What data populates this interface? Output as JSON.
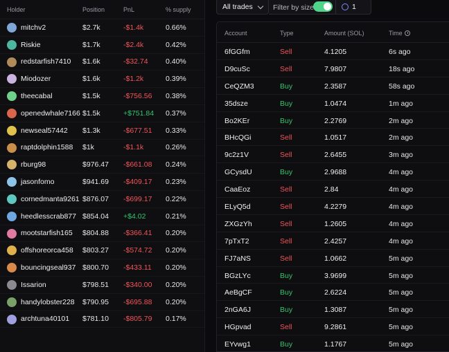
{
  "holders": {
    "headers": {
      "holder": "Holder",
      "position": "Position",
      "pnl": "PnL",
      "supply": "% supply"
    },
    "rows": [
      {
        "name": "mitchv2",
        "position": "$2.7k",
        "pnl": "-$1.4k",
        "supply": "0.66%",
        "pnl_sign": "neg",
        "avatar_color": "#7fa6d6"
      },
      {
        "name": "Riskie",
        "position": "$1.7k",
        "pnl": "-$2.4k",
        "supply": "0.42%",
        "pnl_sign": "neg",
        "avatar_color": "#4db5a0"
      },
      {
        "name": "redstarfish7410",
        "position": "$1.6k",
        "pnl": "-$32.74",
        "supply": "0.40%",
        "pnl_sign": "neg",
        "avatar_color": "#b08a5a"
      },
      {
        "name": "Miodozer",
        "position": "$1.6k",
        "pnl": "-$1.2k",
        "supply": "0.39%",
        "pnl_sign": "neg",
        "avatar_color": "#c9b3e0"
      },
      {
        "name": "theecabal",
        "position": "$1.5k",
        "pnl": "-$756.56",
        "supply": "0.38%",
        "pnl_sign": "neg",
        "avatar_color": "#6fd08a"
      },
      {
        "name": "openedwhale7166",
        "position": "$1.5k",
        "pnl": "+$751.84",
        "supply": "0.37%",
        "pnl_sign": "pos",
        "avatar_color": "#d9664a"
      },
      {
        "name": "newseal57442",
        "position": "$1.3k",
        "pnl": "-$677.51",
        "supply": "0.33%",
        "pnl_sign": "neg",
        "avatar_color": "#e0c24a"
      },
      {
        "name": "raptdolphin1588",
        "position": "$1k",
        "pnl": "-$1.1k",
        "supply": "0.26%",
        "pnl_sign": "neg",
        "avatar_color": "#c98f4a"
      },
      {
        "name": "rburg98",
        "position": "$976.47",
        "pnl": "-$661.08",
        "supply": "0.24%",
        "pnl_sign": "neg",
        "avatar_color": "#d6b36a"
      },
      {
        "name": "jasonfomo",
        "position": "$941.69",
        "pnl": "-$409.17",
        "supply": "0.23%",
        "pnl_sign": "neg",
        "avatar_color": "#8ec3e8"
      },
      {
        "name": "cornedmanta9261",
        "position": "$876.07",
        "pnl": "-$699.17",
        "supply": "0.22%",
        "pnl_sign": "neg",
        "avatar_color": "#5ec8c0"
      },
      {
        "name": "heedlesscrab877",
        "position": "$854.04",
        "pnl": "+$4.02",
        "supply": "0.21%",
        "pnl_sign": "pos",
        "avatar_color": "#6fa8e0"
      },
      {
        "name": "mootstarfish165",
        "position": "$804.88",
        "pnl": "-$366.41",
        "supply": "0.20%",
        "pnl_sign": "neg",
        "avatar_color": "#e07aa0"
      },
      {
        "name": "offshoreorca458",
        "position": "$803.27",
        "pnl": "-$574.72",
        "supply": "0.20%",
        "pnl_sign": "neg",
        "avatar_color": "#e0b04a"
      },
      {
        "name": "bouncingseal937",
        "position": "$800.70",
        "pnl": "-$433.11",
        "supply": "0.20%",
        "pnl_sign": "neg",
        "avatar_color": "#d98a4a"
      },
      {
        "name": "Issarion",
        "position": "$798.51",
        "pnl": "-$340.00",
        "supply": "0.20%",
        "pnl_sign": "neg",
        "avatar_color": "#8a8a90"
      },
      {
        "name": "handylobster228",
        "position": "$790.95",
        "pnl": "-$695.88",
        "supply": "0.20%",
        "pnl_sign": "neg",
        "avatar_color": "#7aa06a"
      },
      {
        "name": "archtuna40101",
        "position": "$781.10",
        "pnl": "-$805.79",
        "supply": "0.17%",
        "pnl_sign": "neg",
        "avatar_color": "#a0a0e0"
      }
    ]
  },
  "controls": {
    "trades_filter": "All trades",
    "filter_by_size_label": "Filter by size",
    "size_value": "1"
  },
  "trades": {
    "headers": {
      "account": "Account",
      "type": "Type",
      "amount": "Amount (SOL)",
      "time": "Time"
    },
    "rows": [
      {
        "account": "6fGGfm",
        "type": "Sell",
        "amount": "4.1205",
        "time": "6s ago"
      },
      {
        "account": "D9cuSc",
        "type": "Sell",
        "amount": "7.9807",
        "time": "18s ago"
      },
      {
        "account": "CeQZM3",
        "type": "Buy",
        "amount": "2.3587",
        "time": "58s ago"
      },
      {
        "account": "35dsze",
        "type": "Buy",
        "amount": "1.0474",
        "time": "1m ago"
      },
      {
        "account": "Bo2KEr",
        "type": "Buy",
        "amount": "2.2769",
        "time": "2m ago"
      },
      {
        "account": "BHcQGi",
        "type": "Sell",
        "amount": "1.0517",
        "time": "2m ago"
      },
      {
        "account": "9c2z1V",
        "type": "Sell",
        "amount": "2.6455",
        "time": "3m ago"
      },
      {
        "account": "GCysdU",
        "type": "Buy",
        "amount": "2.9688",
        "time": "4m ago"
      },
      {
        "account": "CaaEoz",
        "type": "Sell",
        "amount": "2.84",
        "time": "4m ago"
      },
      {
        "account": "ELyQ5d",
        "type": "Sell",
        "amount": "4.2279",
        "time": "4m ago"
      },
      {
        "account": "ZXGzYh",
        "type": "Sell",
        "amount": "1.2605",
        "time": "4m ago"
      },
      {
        "account": "7pTxT2",
        "type": "Sell",
        "amount": "2.4257",
        "time": "4m ago"
      },
      {
        "account": "FJ7aNS",
        "type": "Sell",
        "amount": "1.0662",
        "time": "5m ago"
      },
      {
        "account": "BGzLYc",
        "type": "Buy",
        "amount": "3.9699",
        "time": "5m ago"
      },
      {
        "account": "AeBgCF",
        "type": "Buy",
        "amount": "2.6224",
        "time": "5m ago"
      },
      {
        "account": "2nGA6J",
        "type": "Buy",
        "amount": "1.3087",
        "time": "5m ago"
      },
      {
        "account": "HGpvad",
        "type": "Sell",
        "amount": "9.2861",
        "time": "5m ago"
      },
      {
        "account": "EYvwg1",
        "type": "Buy",
        "amount": "1.1767",
        "time": "5m ago"
      }
    ]
  }
}
